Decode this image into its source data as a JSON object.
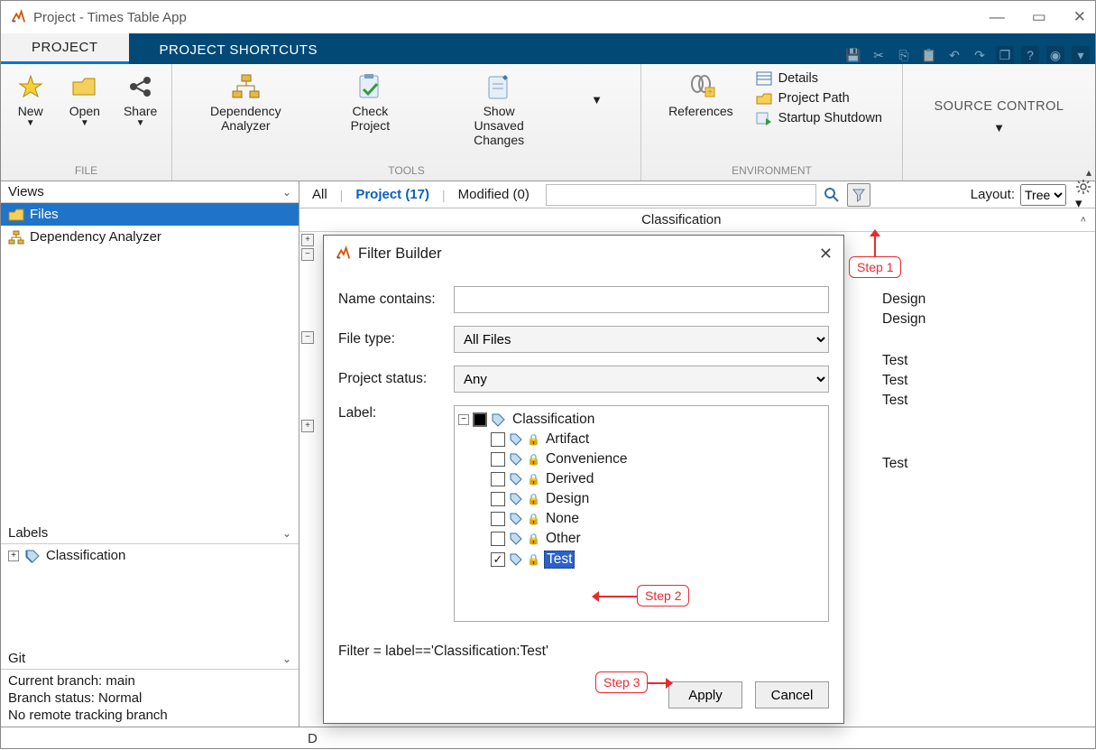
{
  "window": {
    "title": "Project - Times Table App"
  },
  "tabs": {
    "project": "PROJECT",
    "shortcuts": "PROJECT SHORTCUTS"
  },
  "ribbon": {
    "file": {
      "new": "New",
      "open": "Open",
      "share": "Share",
      "group": "FILE"
    },
    "tools": {
      "dep": "Dependency\nAnalyzer",
      "check": "Check Project",
      "unsaved": "Show Unsaved\nChanges",
      "group": "TOOLS"
    },
    "env": {
      "ref": "References",
      "details": "Details",
      "path": "Project Path",
      "startup": "Startup Shutdown",
      "group": "ENVIRONMENT"
    },
    "src": {
      "label": "SOURCE CONTROL"
    }
  },
  "sidebar": {
    "views": "Views",
    "files": "Files",
    "dep": "Dependency Analyzer",
    "labels": "Labels",
    "classification": "Classification",
    "git": "Git",
    "git_lines": [
      "Current branch: main",
      "Branch status: Normal",
      "No remote tracking branch"
    ]
  },
  "filterbar": {
    "all": "All",
    "project": "Project (17)",
    "modified": "Modified (0)",
    "layout": "Layout:",
    "tree": "Tree"
  },
  "subheader": {
    "classification": "Classification"
  },
  "class_values": [
    "Design",
    "Design",
    "",
    "Test",
    "Test",
    "Test",
    "",
    "",
    "Test"
  ],
  "dialog": {
    "title": "Filter Builder",
    "name_contains": "Name contains:",
    "file_type": "File type:",
    "file_type_val": "All Files",
    "project_status": "Project status:",
    "project_status_val": "Any",
    "label": "Label:",
    "root": "Classification",
    "children": [
      "Artifact",
      "Convenience",
      "Derived",
      "Design",
      "None",
      "Other",
      "Test"
    ],
    "checked_index": 6,
    "filterline": "Filter = label=='Classification:Test'",
    "apply": "Apply",
    "cancel": "Cancel"
  },
  "callouts": {
    "s1": "Step 1",
    "s2": "Step 2",
    "s3": "Step 3"
  },
  "statusbar": {
    "d": "D"
  }
}
